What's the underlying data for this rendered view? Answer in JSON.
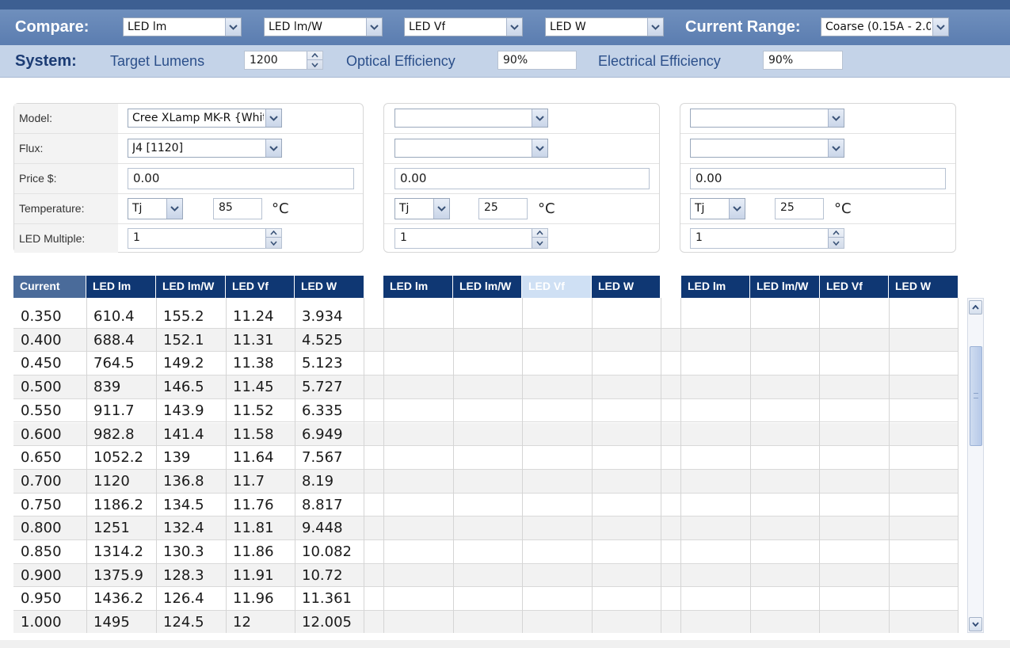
{
  "compare_bar": {
    "label": "Compare:",
    "selects": [
      "LED lm",
      "LED lm/W",
      "LED Vf",
      "LED W"
    ],
    "current_range_label": "Current Range:",
    "current_range_value": "Coarse (0.15A - 2.0"
  },
  "system_bar": {
    "label": "System:",
    "target_lumens_label": "Target Lumens",
    "target_lumens_value": "1200",
    "optical_efficiency_label": "Optical Efficiency",
    "optical_efficiency_value": "90%",
    "electrical_efficiency_label": "Electrical Efficiency",
    "electrical_efficiency_value": "90%"
  },
  "panel_labels": {
    "model": "Model:",
    "flux": "Flux:",
    "price": "Price $:",
    "temperature": "Temperature:",
    "led_multiple": "LED Multiple:"
  },
  "panels": [
    {
      "model": "Cree XLamp MK-R {White",
      "flux": "J4 [1120]",
      "price": "0.00",
      "temp_type": "Tj",
      "temp_value": "85",
      "temp_unit": "°C",
      "led_multiple": "1"
    },
    {
      "model": "",
      "flux": "",
      "price": "0.00",
      "temp_type": "Tj",
      "temp_value": "25",
      "temp_unit": "°C",
      "led_multiple": "1"
    },
    {
      "model": "",
      "flux": "",
      "price": "0.00",
      "temp_type": "Tj",
      "temp_value": "25",
      "temp_unit": "°C",
      "led_multiple": "1"
    }
  ],
  "table": {
    "headers": {
      "current": "Current",
      "group1": [
        "LED lm",
        "LED lm/W",
        "LED Vf",
        "LED W"
      ],
      "group2": [
        "LED lm",
        "LED lm/W",
        "LED Vf",
        "LED W"
      ],
      "group3": [
        "LED lm",
        "LED lm/W",
        "LED Vf",
        "LED W"
      ]
    },
    "rows": [
      [
        "0.350",
        "610.4",
        "155.2",
        "11.24",
        "3.934"
      ],
      [
        "0.400",
        "688.4",
        "152.1",
        "11.31",
        "4.525"
      ],
      [
        "0.450",
        "764.5",
        "149.2",
        "11.38",
        "5.123"
      ],
      [
        "0.500",
        "839",
        "146.5",
        "11.45",
        "5.727"
      ],
      [
        "0.550",
        "911.7",
        "143.9",
        "11.52",
        "6.335"
      ],
      [
        "0.600",
        "982.8",
        "141.4",
        "11.58",
        "6.949"
      ],
      [
        "0.650",
        "1052.2",
        "139",
        "11.64",
        "7.567"
      ],
      [
        "0.700",
        "1120",
        "136.8",
        "11.7",
        "8.19"
      ],
      [
        "0.750",
        "1186.2",
        "134.5",
        "11.76",
        "8.817"
      ],
      [
        "0.800",
        "1251",
        "132.4",
        "11.81",
        "9.448"
      ],
      [
        "0.850",
        "1314.2",
        "130.3",
        "11.86",
        "10.082"
      ],
      [
        "0.900",
        "1375.9",
        "128.3",
        "11.91",
        "10.72"
      ],
      [
        "0.950",
        "1436.2",
        "126.4",
        "11.96",
        "11.361"
      ],
      [
        "1.000",
        "1495",
        "124.5",
        "12",
        "12.005"
      ]
    ]
  },
  "icons": {
    "dropdown": "chevron-down-icon",
    "spin_up": "spin-up-icon",
    "spin_down": "spin-down-icon",
    "scroll_up": "scroll-up-arrow-icon",
    "scroll_down": "scroll-down-arrow-icon"
  },
  "colors": {
    "header_bar": "#6f8fbd",
    "system_bar": "#c4d3e8",
    "table_header": "#0f3773",
    "accent_text": "#2b4f8a"
  }
}
